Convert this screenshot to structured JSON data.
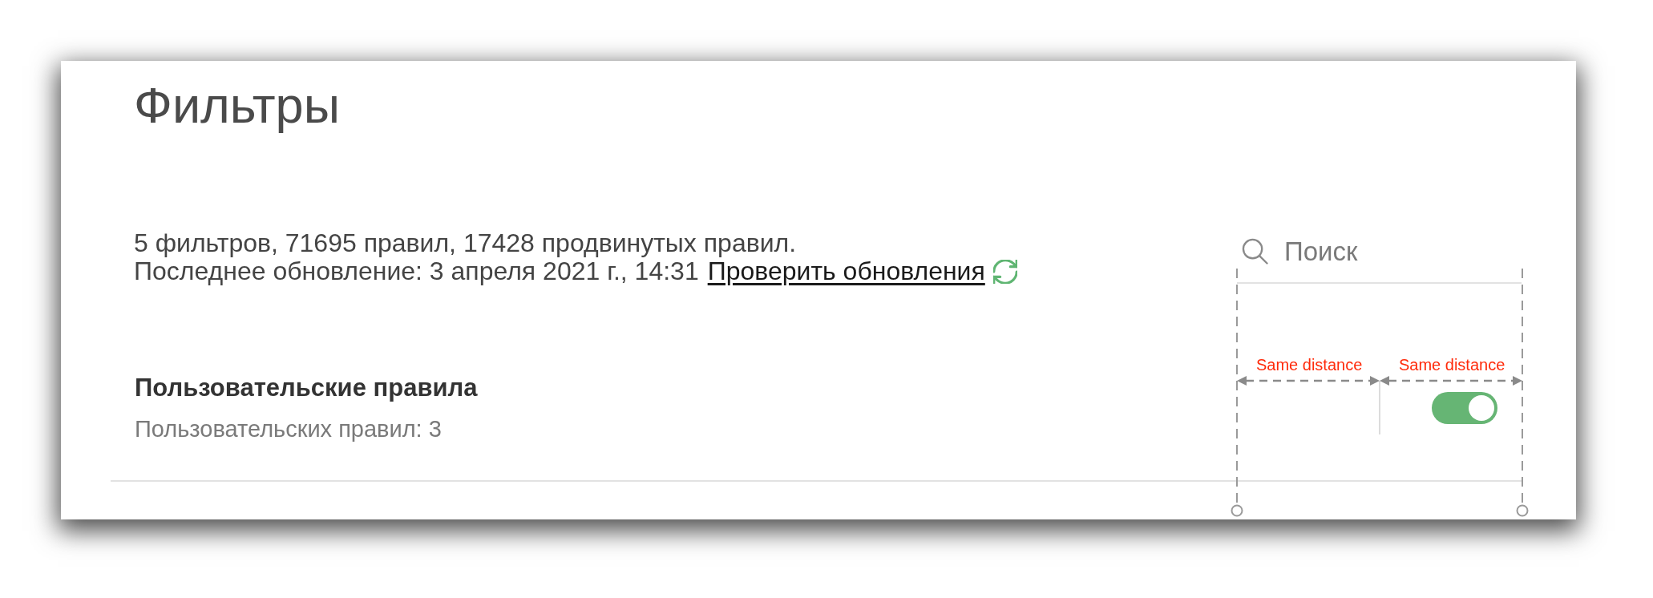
{
  "page": {
    "title": "Фильтры"
  },
  "summary": {
    "stats": "5 фильтров, 71695 правил, 17428 продвинутых правил.",
    "last_update": "Последнее обновление: 3 апреля 2021 г., 14:31",
    "check_link": "Проверить обновления"
  },
  "search": {
    "placeholder": "Поиск"
  },
  "filters": [
    {
      "title": "Пользовательские правила",
      "subtitle": "Пользовательских правил: 3",
      "on": true
    }
  ],
  "annotations": [
    {
      "label": "Same distance"
    },
    {
      "label": "Same distance"
    }
  ]
}
